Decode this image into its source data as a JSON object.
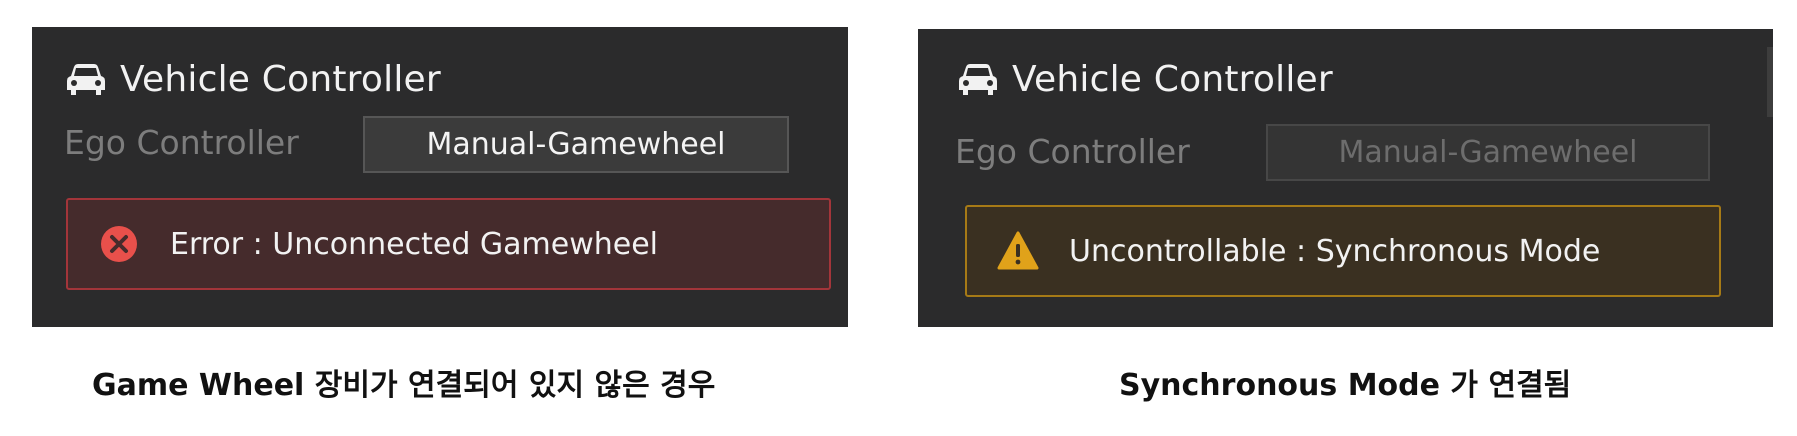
{
  "panels": [
    {
      "header_title": "Vehicle Controller",
      "ego_label": "Ego Controller",
      "controller_value": "Manual-Gamewheel",
      "alert_text": "Error : Unconnected Gamewheel",
      "alert_kind": "error",
      "caption": "Game Wheel 장비가 연결되어 있지 않은 경우"
    },
    {
      "header_title": "Vehicle Controller",
      "ego_label": "Ego Controller",
      "controller_value": "Manual-Gamewheel",
      "alert_text": "Uncontrollable :  Synchronous Mode",
      "alert_kind": "warning",
      "caption": "Synchronous Mode 가 연결됨"
    }
  ],
  "icons": {
    "header": "car-icon",
    "error": "error-circle-x-icon",
    "warning": "warning-triangle-icon"
  },
  "colors": {
    "panel_bg": "#2b2b2c",
    "error_border": "#a3353a",
    "error_icon": "#e8504b",
    "warning_border": "#a67a16",
    "warning_icon": "#e0a21a",
    "text": "#f2f2f2",
    "muted": "#7d7d7d"
  }
}
